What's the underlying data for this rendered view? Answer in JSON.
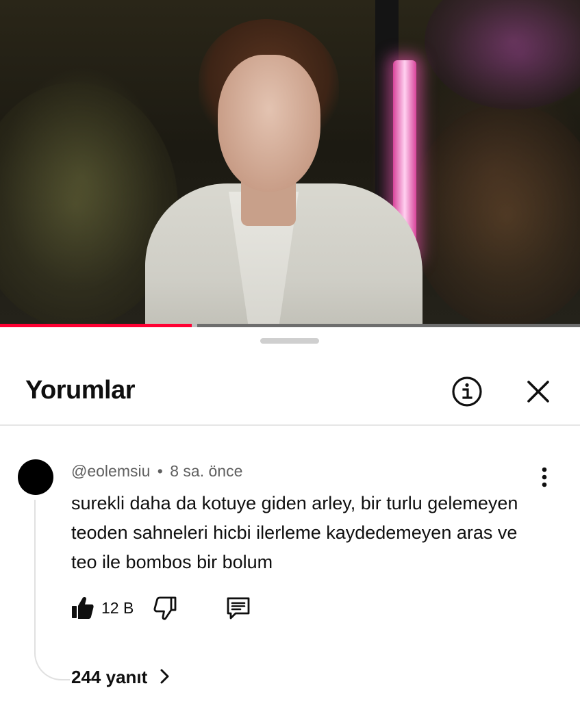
{
  "video": {
    "progress_fraction": 0.33,
    "buffer_fraction": 0.34
  },
  "comments_panel": {
    "title": "Yorumlar",
    "icons": {
      "info": "info-circle-icon",
      "close": "close-icon"
    }
  },
  "comment": {
    "author": "@eolemsiu",
    "separator": "•",
    "time": "8 sa. önce",
    "text": "surekli daha da kotuye giden arley, bir turlu gelemeyen teoden sahneleri hicbi ilerleme kaydedemeyen aras ve teo ile bombos bir bolum",
    "like_count": "12 B",
    "icons": {
      "like": "thumbs-up-icon",
      "dislike": "thumbs-down-icon",
      "reply": "comment-reply-icon",
      "more": "more-vertical-icon"
    },
    "replies_label": "244 yanıt"
  },
  "colors": {
    "progress": "#ff0033",
    "text_primary": "#0f0f0f",
    "text_secondary": "#606060"
  }
}
